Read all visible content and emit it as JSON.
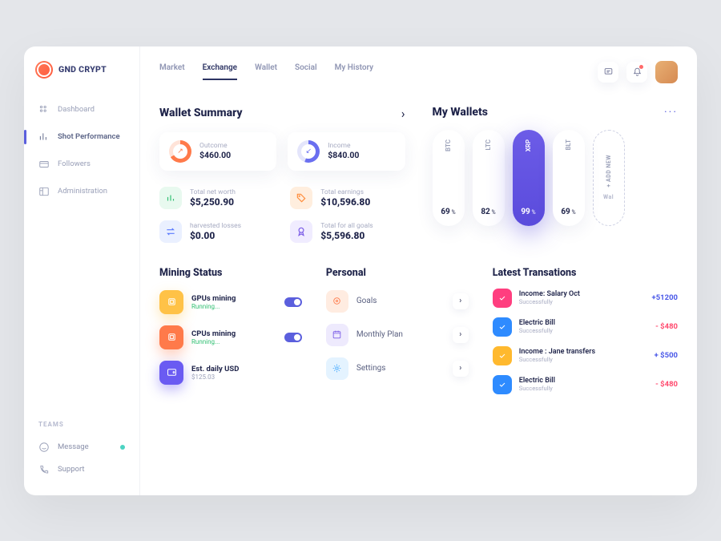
{
  "brand": {
    "name": "GND CRYPT"
  },
  "sidebar": {
    "items": [
      {
        "label": "Dashboard"
      },
      {
        "label": "Shot Performance"
      },
      {
        "label": "Followers"
      },
      {
        "label": "Administration"
      }
    ],
    "teams_label": "TEAMS",
    "teams": [
      {
        "label": "Message",
        "badge": true
      },
      {
        "label": "Support",
        "badge": false
      }
    ]
  },
  "tabs": [
    "Market",
    "Exchange",
    "Wallet",
    "Social",
    "My History"
  ],
  "active_tab": 1,
  "summary": {
    "title": "Wallet Summary",
    "outcome": {
      "label": "Outcome",
      "value": "$460.00"
    },
    "income": {
      "label": "Income",
      "value": "$840.00"
    },
    "stats": [
      {
        "label": "Total net worth",
        "value": "$5,250.90"
      },
      {
        "label": "Total earnings",
        "value": "$10,596.80"
      },
      {
        "label": "harvested losses",
        "value": "$0.00"
      },
      {
        "label": "Total for all goals",
        "value": "$5,596.80"
      }
    ]
  },
  "wallets": {
    "title": "My Wallets",
    "items": [
      {
        "name": "BTC",
        "pct": "69"
      },
      {
        "name": "LTC",
        "pct": "82"
      },
      {
        "name": "XRP",
        "pct": "99"
      },
      {
        "name": "BLT",
        "pct": "69"
      }
    ],
    "active": 2,
    "add_label": "+ ADD NEW",
    "add_hint": "Wal"
  },
  "mining": {
    "title": "Mining Status",
    "items": [
      {
        "title": "GPUs mining",
        "sub": "Running...",
        "toggle": true
      },
      {
        "title": "CPUs mining",
        "sub": "Running...",
        "toggle": true
      },
      {
        "title": "Est. daily USD",
        "val": "$125.03"
      }
    ]
  },
  "personal": {
    "title": "Personal",
    "items": [
      {
        "title": "Goals"
      },
      {
        "title": "Monthly Plan"
      },
      {
        "title": "Settings"
      }
    ]
  },
  "transactions": {
    "title": "Latest Transations",
    "items": [
      {
        "title": "Income: Salary Oct",
        "sub": "Successfully",
        "amt": "+51200",
        "cls": "pos",
        "icon": "ti-pink"
      },
      {
        "title": "Electric Bill",
        "sub": "Successfully",
        "amt": "- $480",
        "cls": "neg",
        "icon": "ti-blue"
      },
      {
        "title": "Income : Jane transfers",
        "sub": "Successfully",
        "amt": "+ $500",
        "cls": "pos",
        "icon": "ti-yellow"
      },
      {
        "title": "Electric Bill",
        "sub": "Successfully",
        "amt": "- $480",
        "cls": "neg",
        "icon": "ti-blue"
      }
    ]
  }
}
